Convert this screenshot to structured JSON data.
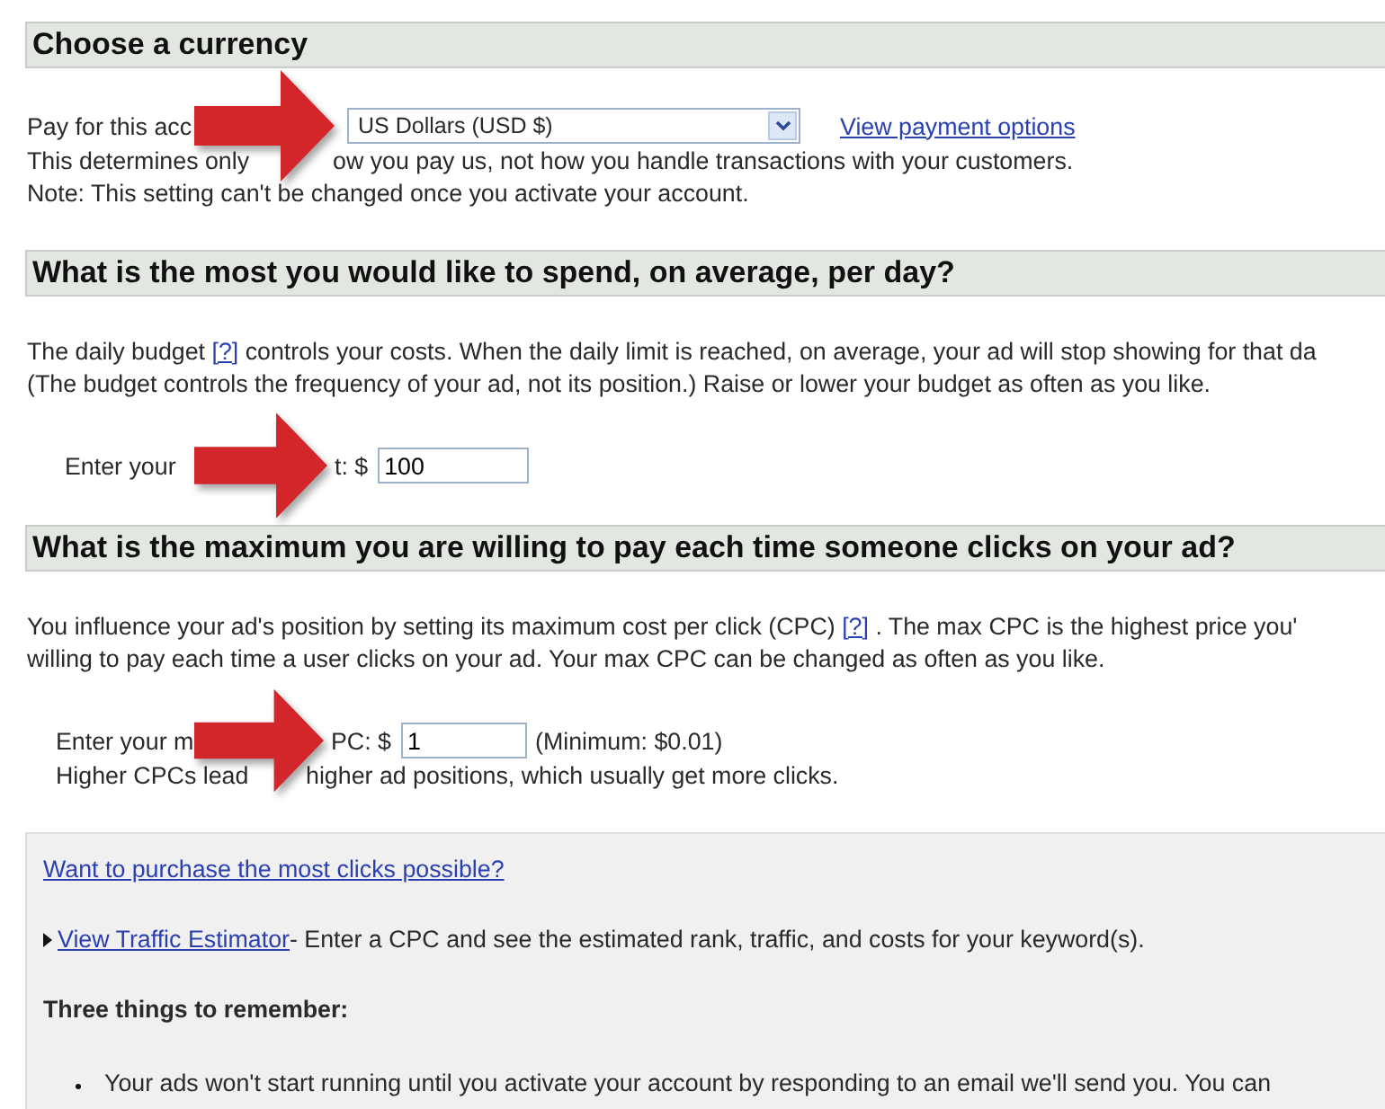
{
  "currency": {
    "heading": "Choose a currency",
    "label": "Pay for this acc",
    "select": {
      "value": "US Dollars (USD $)"
    },
    "link": "View payment options",
    "lines": [
      {
        "before": "This determines only",
        "after": "ow you pay us, not how you handle transactions with your customers."
      },
      {
        "before": "Note: This setting can't be changed once you activate your account."
      }
    ]
  },
  "budget": {
    "heading": "What is the most you would like to spend, on average, per day?",
    "para": {
      "before": "The daily budget ",
      "link": "[?]",
      "after": " controls your costs. When the daily limit is reached, on average, your ad will stop showing for that da"
    },
    "para_line_2": "(The budget controls the frequency of your ad, not its position.) Raise or lower your budget as often as you like.",
    "field": {
      "label_start": "Enter your",
      "label_end": "t: $",
      "value": "100"
    }
  },
  "cpc": {
    "heading": "What is the maximum you are willing to pay each time someone clicks on your ad?",
    "para": {
      "before": "You influence your ad's position by setting its maximum cost per click (CPC) ",
      "link": "[?]",
      "after": " . The max CPC is the highest price you'"
    },
    "para_line_2": "willing to pay each time a user clicks on your ad. Your max CPC can be changed as often as you like.",
    "field": {
      "label_start": "Enter your m",
      "label_end": "PC: $",
      "value": "1",
      "hint": "(Minimum: $0.01)"
    },
    "note": {
      "before": "Higher CPCs lead",
      "after": "higher ad positions, which usually get more clicks."
    }
  },
  "tips": {
    "link": "Want to purchase the most clicks possible?",
    "estimator": {
      "link": "View Traffic Estimator",
      "text": " - Enter a CPC and see the estimated rank, traffic, and costs for your keyword(s)."
    },
    "heading": "Three things to remember:",
    "bullets": [
      "Your ads won't start running until you activate your account by responding to an email we'll send you. You can"
    ]
  }
}
